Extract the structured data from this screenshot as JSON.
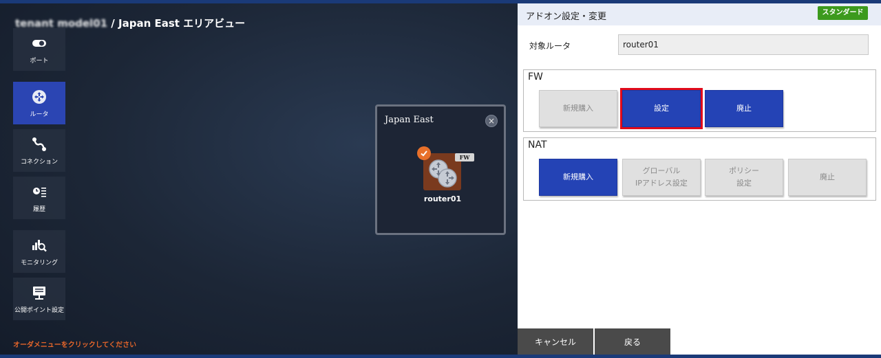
{
  "breadcrumb": {
    "tenant": "tenant model01",
    "separator": " / ",
    "area": "Japan East エリアビュー"
  },
  "side_nav": {
    "items": [
      {
        "label": "ポート",
        "icon": "toggle-icon"
      },
      {
        "label": "ルータ",
        "icon": "router-icon",
        "active": true
      },
      {
        "label": "コネクション",
        "icon": "connection-icon"
      },
      {
        "label": "履歴",
        "icon": "history-icon"
      },
      {
        "label": "モニタリング",
        "icon": "monitoring-icon"
      },
      {
        "label": "公開ポイント設定",
        "icon": "public-point-icon"
      }
    ]
  },
  "order_hint": "オーダメニューをクリックしてください",
  "region_card": {
    "title": "Japan East",
    "close_symbol": "×",
    "router": {
      "name": "router01",
      "badge": "FW",
      "selected": true
    }
  },
  "panel": {
    "title": "アドオン設定・変更",
    "plan_badge": "スタンダード",
    "target_label": "対象ルータ",
    "target_value": "router01",
    "fw": {
      "title": "FW",
      "buttons": [
        {
          "label": "新規購入",
          "state": "disabled"
        },
        {
          "label": "設定",
          "state": "primary",
          "highlighted": true
        },
        {
          "label": "廃止",
          "state": "primary"
        }
      ]
    },
    "nat": {
      "title": "NAT",
      "buttons": [
        {
          "label": "新規購入",
          "state": "primary"
        },
        {
          "line1": "グローバル",
          "line2": "IPアドレス設定",
          "state": "disabled"
        },
        {
          "line1": "ポリシー",
          "line2": "設定",
          "state": "disabled"
        },
        {
          "label": "廃止",
          "state": "disabled"
        }
      ]
    },
    "footer": {
      "cancel": "キャンセル",
      "back": "戻る"
    }
  },
  "colors": {
    "accent_blue": "#2443b5",
    "highlight_red": "#e10b1b",
    "badge_green": "#3c9a1d",
    "hint_orange": "#e5652a",
    "router_tile": "#7a3a1e"
  }
}
